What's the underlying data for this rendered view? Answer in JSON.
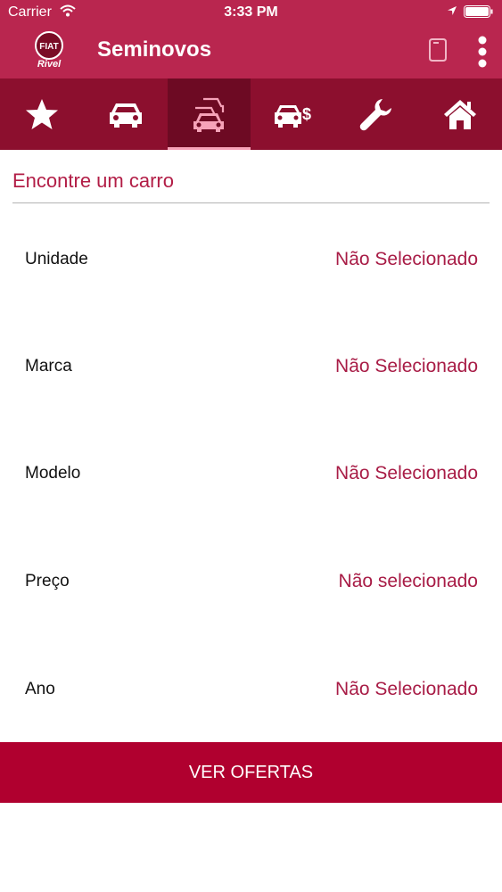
{
  "status_bar": {
    "carrier": "Carrier",
    "time": "3:33 PM"
  },
  "header": {
    "title": "Seminovos",
    "logo_icon": "fiat-rivel-logo-icon",
    "copy_icon": "copy-icon",
    "more_icon": "more-vertical-icon"
  },
  "tabs": [
    {
      "icon": "star-icon",
      "active": false
    },
    {
      "icon": "car-icon",
      "active": false
    },
    {
      "icon": "cars-stack-icon",
      "active": true
    },
    {
      "icon": "car-price-icon",
      "active": false
    },
    {
      "icon": "wrench-icon",
      "active": false
    },
    {
      "icon": "home-icon",
      "active": false
    }
  ],
  "search": {
    "title": "Encontre um carro",
    "filters": [
      {
        "label": "Unidade",
        "value": "Não Selecionado"
      },
      {
        "label": "Marca",
        "value": "Não Selecionado"
      },
      {
        "label": "Modelo",
        "value": "Não Selecionado"
      },
      {
        "label": "Preço",
        "value": "Não selecionado"
      },
      {
        "label": "Ano",
        "value": "Não Selecionado"
      }
    ]
  },
  "cta": {
    "label": "VER OFERTAS"
  },
  "colors": {
    "header": "#b9264f",
    "tabbar": "#8c0f2e",
    "tab_active": "#6d0a23",
    "accent": "#b0002f",
    "value_text": "#a81c46",
    "active_icon": "#f6a2b8"
  }
}
